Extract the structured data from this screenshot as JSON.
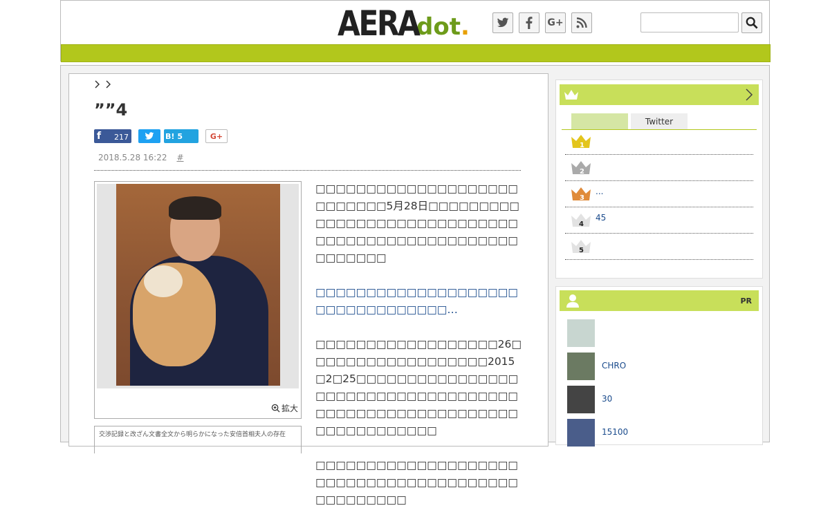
{
  "header": {
    "logo_main": "AERA",
    "logo_sub": "dot",
    "logo_period": ".",
    "social": [
      "twitter-icon",
      "facebook-icon",
      "google-plus-icon",
      "rss-icon"
    ],
    "search_placeholder": ""
  },
  "article": {
    "title": "””4",
    "share": {
      "facebook_count": "217",
      "hatena_count": "5",
      "hatena_label": "B!",
      "gplus_label": "G+"
    },
    "date": "2018.5.28 16:22",
    "hash": "#",
    "enlarge_label": "拡大",
    "caption": "交渉記録と改ざん文書全文から明らかになった安倍首相夫人の存在",
    "paragraphs": [
      "□□□□□□□□□□□□□□□□□□□□□□□□□□□5月28日□□□□□□□□□□□□□□□□□□□□□□□□□□□□□□□□□□□□□□□□□□□□□□□□□□□□□□□□",
      "□□□□□□□□□□□□□□□□□□□□□□□□□□□□□□□□□…",
      "□□□□□□□□□□□□□□□□□□26□□□□□□□□□□□□□□□□□□2015□2□25□□□□□□□□□□□□□□□□□□□□□□□□□□□□□□□□□□□□□□□□□□□□□□□□□□□□□□□□□□□□□□□□□□□□",
      "□□□□□□□□□□□□□□□□□□□□□□□□□□□□□□□□□□□□□□□□□□□□□□□□□"
    ]
  },
  "ranking": {
    "tabs": [
      "",
      "Twitter"
    ],
    "items": [
      {
        "rank": "1",
        "text": ""
      },
      {
        "rank": "2",
        "text": ""
      },
      {
        "rank": "3",
        "text": "..."
      },
      {
        "rank": "4",
        "text": "45"
      },
      {
        "rank": "5",
        "text": ""
      }
    ],
    "colors": {
      "gold": "#e3c51c",
      "silver": "#aaaaaa",
      "bronze": "#e08b3a",
      "plain": "#cccccc"
    }
  },
  "people": {
    "pr_label": "PR",
    "items": [
      {
        "text": ""
      },
      {
        "text": "CHRO"
      },
      {
        "text": "30"
      },
      {
        "text": "15100"
      }
    ]
  },
  "colors": {
    "brand_green": "#b2c71c",
    "bar_green": "#c8df5a",
    "link": "#1a4b8c"
  }
}
